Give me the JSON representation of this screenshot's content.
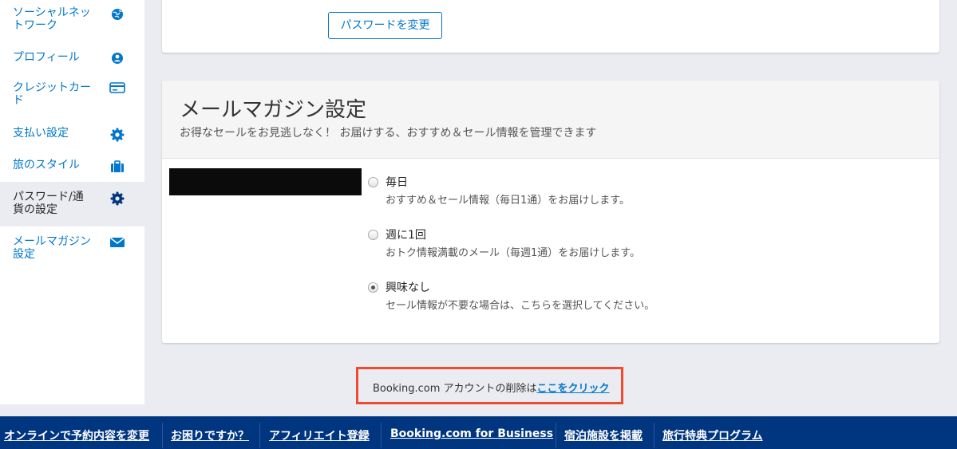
{
  "sidebar": {
    "items": [
      {
        "label": "ソーシャルネットワーク",
        "icon": "globe-icon"
      },
      {
        "label": "プロフィール",
        "icon": "user-icon"
      },
      {
        "label": "クレジットカード",
        "icon": "credit-card-icon"
      },
      {
        "label": "支払い設定",
        "icon": "gear-icon"
      },
      {
        "label": "旅のスタイル",
        "icon": "suitcase-icon"
      },
      {
        "label": "パスワード/通貨の設定",
        "icon": "gear-icon",
        "active": true
      },
      {
        "label": "メールマガジン設定",
        "icon": "envelope-icon"
      }
    ]
  },
  "password": {
    "change_button": "パスワードを変更"
  },
  "newsletter": {
    "title": "メールマガジン設定",
    "subtitle": "お得なセールをお見逃しなく！ お届けする、おすすめ＆セール情報を管理できます",
    "options": [
      {
        "label": "毎日",
        "description": "おすすめ＆セール情報（毎日1通）をお届けします。",
        "checked": false
      },
      {
        "label": "週に1回",
        "description": "おトク情報満載のメール（毎週1通）をお届けします。",
        "checked": false
      },
      {
        "label": "興味なし",
        "description": "セール情報が不要な場合は、こちらを選択してください。",
        "checked": true
      }
    ]
  },
  "delete_account": {
    "text": "Booking.com アカウントの削除は",
    "link": "ここをクリック"
  },
  "footer": {
    "links": [
      "オンラインで予約内容を変更",
      "お困りですか？",
      "アフィリエイト登録",
      "Booking.com for Business",
      "宿泊施設を掲載",
      "旅行特典プログラム"
    ]
  },
  "colors": {
    "accent": "#0077cc",
    "footer_bg": "#003580",
    "highlight_border": "#ef4b2e",
    "page_bg": "#ebecf1"
  }
}
